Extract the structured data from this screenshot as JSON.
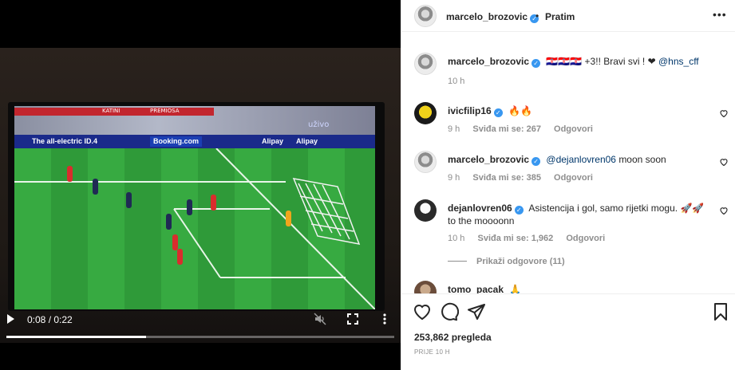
{
  "video": {
    "time": "0:08 / 0:22",
    "progress": 0.36,
    "broadcast": {
      "stand_text_1": "KATINI",
      "stand_text_2": "PREMIOSA",
      "channel": "uživo",
      "ad_1": "The all-electric ID.4",
      "ad_2": "Booking.com",
      "ad_3": "Alipay",
      "ad_4": "Alipay"
    }
  },
  "header": {
    "username": "marcelo_brozovic",
    "separator": "•",
    "follow_label": "Pratim",
    "more_label": "•••"
  },
  "caption": {
    "username": "marcelo_brozovic",
    "text": "🇭🇷🇭🇷🇭🇷 +3!! Bravi svi ! ❤",
    "mention": "@hns_cff",
    "time": "10 h"
  },
  "comments": [
    {
      "username": "ivicfilip16",
      "text": "🔥🔥",
      "time": "9 h",
      "likes": "Sviđa mi se: 267",
      "reply": "Odgovori"
    },
    {
      "username": "marcelo_brozovic",
      "mention": "@dejanlovren06",
      "text": "moon soon",
      "time": "9 h",
      "likes": "Sviđa mi se: 385",
      "reply": "Odgovori"
    },
    {
      "username": "dejanlovren06",
      "text": "Asistencija i gol, samo rijetki mogu. 🚀🚀 to the moooonn",
      "time": "10 h",
      "likes": "Sviđa mi se: 1,962",
      "reply": "Odgovori"
    },
    {
      "username": "tomo_pacak",
      "text": "🙏"
    }
  ],
  "view_replies": "Prikaži odgovore (11)",
  "footer": {
    "views": "253,862 pregleda",
    "posted": "PRIJE 10 H"
  },
  "colors": {
    "link": "#00376b",
    "muted": "#8e8e8e",
    "verified": "#3897f0",
    "pitch": "#37aa41"
  }
}
